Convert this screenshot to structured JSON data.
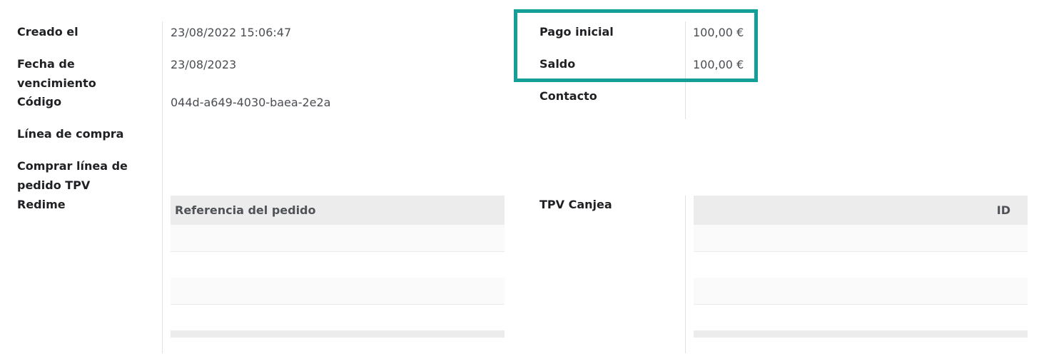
{
  "left_fields": {
    "created_label": "Creado el",
    "created_value": "23/08/2022 15:06:47",
    "expiration_label": "Fecha de vencimiento",
    "expiration_value": "23/08/2023",
    "code_label": "Código",
    "code_value": "044d-a649-4030-baea-2e2a",
    "purchase_line_label": "Línea de compra",
    "pos_purchase_line_label": "Comprar línea de pedido TPV",
    "redeem_label": "Redime"
  },
  "right_fields": {
    "initial_payment_label": "Pago inicial",
    "initial_payment_value": "100,00 €",
    "balance_label": "Saldo",
    "balance_value": "100,00 €",
    "contact_label": "Contacto",
    "contact_value": "",
    "pos_redeem_label": "TPV Canjea"
  },
  "redeem_table": {
    "header": "Referencia del pedido",
    "rows": [
      "",
      "",
      "",
      ""
    ]
  },
  "pos_redeem_table": {
    "header": "ID",
    "rows": [
      "",
      "",
      "",
      ""
    ]
  },
  "colors": {
    "highlight": "#139e97",
    "table_header_bg": "#ececec"
  }
}
